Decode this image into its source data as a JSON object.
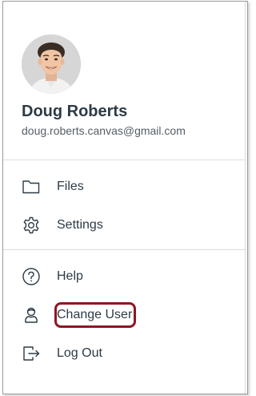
{
  "profile": {
    "name": "Doug Roberts",
    "email": "doug.roberts.canvas@gmail.com"
  },
  "menu": {
    "group1": [
      {
        "label": "Files",
        "icon": "folder-icon"
      },
      {
        "label": "Settings",
        "icon": "gear-icon"
      }
    ],
    "group2": [
      {
        "label": "Help",
        "icon": "help-icon"
      },
      {
        "label": "Change User",
        "icon": "user-icon"
      },
      {
        "label": "Log Out",
        "icon": "logout-icon"
      }
    ]
  },
  "colors": {
    "text": "#2d3b45",
    "highlight": "#8e1625"
  }
}
